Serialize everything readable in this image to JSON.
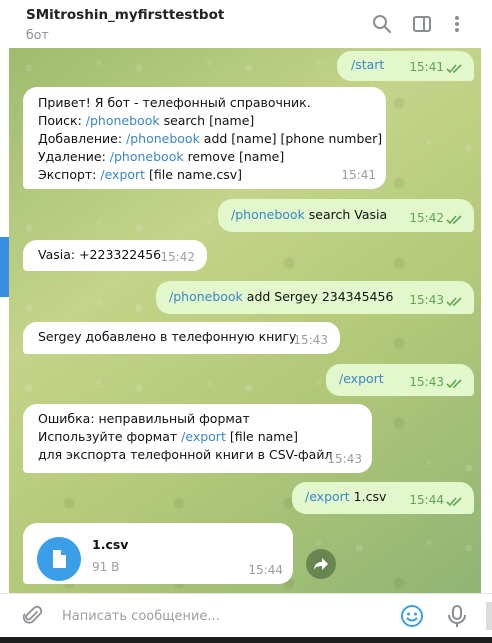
{
  "header": {
    "title": "SMitroshin_myfirsttestbot",
    "subtitle": "бот"
  },
  "icons": {
    "search": "search-icon",
    "sidebar": "sidebar-toggle-icon",
    "more": "more-vertical-icon",
    "attach": "paperclip-icon",
    "emoji": "emoji-icon",
    "mic": "microphone-icon",
    "file": "file-icon",
    "share": "share-icon"
  },
  "colors": {
    "accent": "#3a9ee8",
    "outgoing_bubble": "#e2f7cb",
    "link": "#3a86c7",
    "read_check": "#5da653"
  },
  "messages": [
    {
      "dir": "out",
      "parts": [
        {
          "cmd": "/start"
        }
      ],
      "time": "15:41"
    },
    {
      "dir": "in",
      "lines": [
        [
          {
            "t": "Привет! Я бот - телефонный справочник."
          }
        ],
        [
          {
            "t": "Поиск: "
          },
          {
            "cmd": "/phonebook"
          },
          {
            "t": " search [name]"
          }
        ],
        [
          {
            "t": "Добавление: "
          },
          {
            "cmd": "/phonebook"
          },
          {
            "t": " add [name] [phone number]"
          }
        ],
        [
          {
            "t": "Удаление: "
          },
          {
            "cmd": "/phonebook"
          },
          {
            "t": " remove [name]"
          }
        ],
        [
          {
            "t": "Экспорт: "
          },
          {
            "cmd": "/export"
          },
          {
            "t": " [file name.csv]"
          }
        ]
      ],
      "time": "15:41"
    },
    {
      "dir": "out",
      "parts": [
        {
          "cmd": "/phonebook"
        },
        {
          "t": " search Vasia"
        }
      ],
      "time": "15:42"
    },
    {
      "dir": "in",
      "lines": [
        [
          {
            "t": "Vasia: +223322456"
          }
        ]
      ],
      "time": "15:42"
    },
    {
      "dir": "out",
      "parts": [
        {
          "cmd": "/phonebook"
        },
        {
          "t": " add Sergey 234345456"
        }
      ],
      "time": "15:43"
    },
    {
      "dir": "in",
      "lines": [
        [
          {
            "t": "Sergey добавлено в телефонную книгу"
          }
        ]
      ],
      "time": "15:43"
    },
    {
      "dir": "out",
      "parts": [
        {
          "cmd": "/export"
        }
      ],
      "time": "15:43"
    },
    {
      "dir": "in",
      "lines": [
        [
          {
            "t": "Ошибка: неправильный формат"
          }
        ],
        [
          {
            "t": "Используйте формат "
          },
          {
            "cmd": "/export"
          },
          {
            "t": " [file name]"
          }
        ],
        [
          {
            "t": "для экспорта телефонной книги в CSV-файл"
          }
        ]
      ],
      "time": "15:43"
    },
    {
      "dir": "out",
      "parts": [
        {
          "cmd": "/export"
        },
        {
          "t": " 1.csv"
        }
      ],
      "time": "15:44"
    }
  ],
  "file_message": {
    "name": "1.csv",
    "size": "91 B",
    "time": "15:44"
  },
  "composer": {
    "placeholder": "Написать сообщение..."
  }
}
